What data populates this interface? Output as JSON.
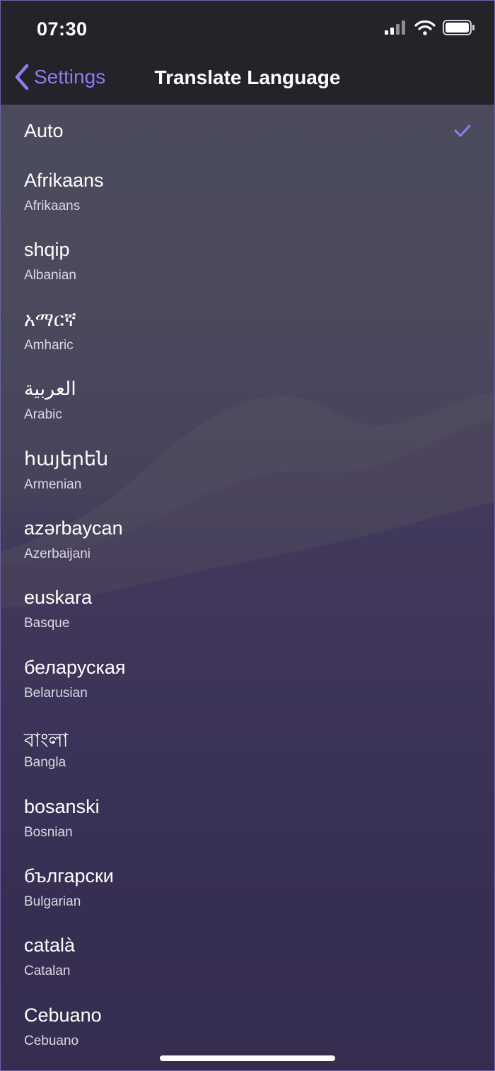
{
  "status_bar": {
    "time": "07:30",
    "icons": [
      "cellular-signal-icon",
      "wifi-icon",
      "battery-icon"
    ]
  },
  "nav": {
    "back_label": "Settings",
    "title": "Translate Language"
  },
  "auto_option": {
    "label": "Auto",
    "selected": true
  },
  "languages": [
    {
      "native": "Afrikaans",
      "english": "Afrikaans"
    },
    {
      "native": "shqip",
      "english": "Albanian"
    },
    {
      "native": "አማርኛ",
      "english": "Amharic"
    },
    {
      "native": "العربية",
      "english": "Arabic"
    },
    {
      "native": "հայերեն",
      "english": "Armenian"
    },
    {
      "native": "azərbaycan",
      "english": "Azerbaijani"
    },
    {
      "native": "euskara",
      "english": "Basque"
    },
    {
      "native": "беларуская",
      "english": "Belarusian"
    },
    {
      "native": "বাংলা",
      "english": "Bangla"
    },
    {
      "native": "bosanski",
      "english": "Bosnian"
    },
    {
      "native": "български",
      "english": "Bulgarian"
    },
    {
      "native": "català",
      "english": "Catalan"
    },
    {
      "native": "Cebuano",
      "english": "Cebuano"
    }
  ],
  "colors": {
    "accent": "#8c7ef0",
    "nav_background": "#232329",
    "text_primary": "#ffffff",
    "text_secondary": "#d9d9e3"
  }
}
